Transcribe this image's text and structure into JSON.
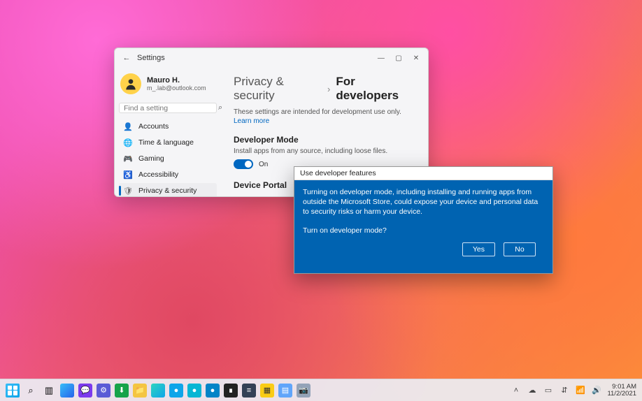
{
  "window": {
    "title": "Settings",
    "controls": {
      "min": "—",
      "max": "▢",
      "close": "✕"
    },
    "back": "←"
  },
  "profile": {
    "name": "Mauro H.",
    "email": "m_.lab@outlook.com"
  },
  "search": {
    "placeholder": "Find a setting"
  },
  "nav": {
    "accounts": "Accounts",
    "time": "Time & language",
    "gaming": "Gaming",
    "accessibility": "Accessibility",
    "privacy": "Privacy & security"
  },
  "breadcrumb": {
    "parent": "Privacy & security",
    "sep": "›",
    "current": "For developers"
  },
  "content": {
    "intro": "These settings are intended for development use only.",
    "learn": "Learn more",
    "devmode_h": "Developer Mode",
    "devmode_sub": "Install apps from any source, including loose files.",
    "toggle_state": "On",
    "portal_h": "Device Portal"
  },
  "dialog": {
    "title": "Use developer features",
    "body": "Turning on developer mode, including installing and running apps from outside the Microsoft Store, could expose your device and personal data to security risks or harm your device.",
    "question": "Turn on developer mode?",
    "yes": "Yes",
    "no": "No"
  },
  "taskbar": {
    "tray": {
      "time": "9:01 AM",
      "date": "11/2/2021"
    }
  },
  "icons": {
    "accounts": "👤",
    "time": "🌐",
    "gaming": "🎮",
    "accessibility": "♿",
    "privacy": "🛡",
    "chevup": "˄",
    "cloud": "☁",
    "battery": "▭",
    "net": "⇵",
    "wifi": "📶",
    "vol": "🔊"
  }
}
